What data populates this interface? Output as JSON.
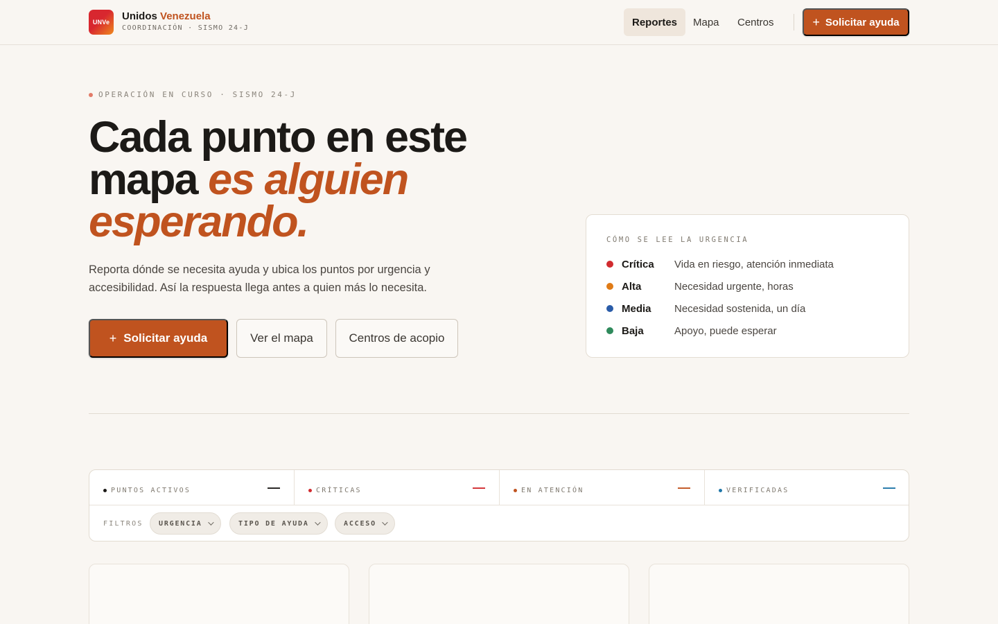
{
  "brand": {
    "logo_text": "UNVe",
    "name_primary": "Unidos",
    "name_accent": "Venezuela",
    "subtitle": "COORDINACIÓN · SISMO 24-J"
  },
  "nav": {
    "items": [
      {
        "label": "Reportes",
        "active": true
      },
      {
        "label": "Mapa",
        "active": false
      },
      {
        "label": "Centros",
        "active": false
      }
    ],
    "cta_label": "Solicitar ayuda",
    "cta_icon": "plus-icon"
  },
  "hero": {
    "eyebrow": "OPERACIÓN EN CURSO · SISMO 24-J",
    "title_plain": "Cada punto en este mapa",
    "title_accent": "es alguien esperando.",
    "description": "Reporta dónde se necesita ayuda y ubica los puntos por urgencia y accesibilidad. Así la respuesta llega antes a quien más lo necesita.",
    "primary_button": "Solicitar ayuda",
    "secondary_buttons": [
      "Ver el mapa",
      "Centros de acopio"
    ]
  },
  "legend": {
    "title": "CÓMO SE LEE LA URGENCIA",
    "items": [
      {
        "name": "Crítica",
        "description": "Vida en riesgo, atención inmediata",
        "color": "#d12b2f"
      },
      {
        "name": "Alta",
        "description": "Necesidad urgente, horas",
        "color": "#e07b16"
      },
      {
        "name": "Media",
        "description": "Necesidad sostenida, un día",
        "color": "#2a5ca8"
      },
      {
        "name": "Baja",
        "description": "Apoyo, puede esperar",
        "color": "#2f8a5c"
      }
    ]
  },
  "stats": [
    {
      "label": "PUNTOS ACTIVOS",
      "value": "—",
      "color": "#1c1a17"
    },
    {
      "label": "CRÍTICAS",
      "value": "—",
      "color": "#d12b2f"
    },
    {
      "label": "EN ATENCIÓN",
      "value": "—",
      "color": "#c0531f"
    },
    {
      "label": "VERIFICADAS",
      "value": "—",
      "color": "#1f76a8"
    }
  ],
  "filters": {
    "label": "FILTROS",
    "chips": [
      "URGENCIA",
      "TIPO DE AYUDA",
      "ACCESO"
    ]
  },
  "colors": {
    "accent": "#c0531f",
    "background": "#f9f6f2"
  }
}
